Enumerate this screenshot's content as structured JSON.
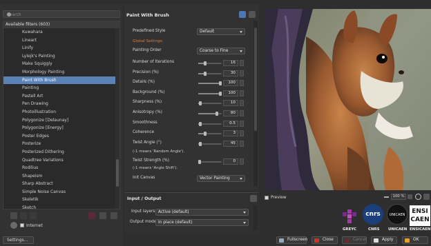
{
  "search": {
    "placeholder": "Search"
  },
  "filters": {
    "header": "Available filters (603)",
    "items": [
      "Kuwahara",
      "Lineart",
      "Linify",
      "Lylejk's Painting",
      "Make Squiggly",
      "Morphology Painting",
      "Paint With Brush",
      "Painting",
      "Pastell Art",
      "Pen Drawing",
      "Photoillustration",
      "Polygonize [Delaunay]",
      "Polygonize [Energy]",
      "Poster Edges",
      "Posterize",
      "Posterized Dithering",
      "Quadtree Variations",
      "Rodilius",
      "Shapeism",
      "Sharp Abstract",
      "Simple Noise Canvas",
      "Skeletik",
      "Sketch"
    ],
    "selected_index": 6,
    "internet_label": "Internet"
  },
  "settings_button": "Settings...",
  "panel": {
    "title": "Paint With Brush",
    "predefined_label": "Predefined Style",
    "predefined_value": "Default",
    "global_label": "Global Settings:",
    "painting_order_label": "Painting Order",
    "painting_order_value": "Coarse to Fine",
    "params": [
      {
        "label": "Number of Iterations",
        "value": "16",
        "fraction": 0.3
      },
      {
        "label": "Precision (%)",
        "value": "30",
        "fraction": 0.3
      },
      {
        "label": "Details (%)",
        "value": "100",
        "fraction": 1.0
      },
      {
        "label": "Background (%)",
        "value": "100",
        "fraction": 1.0
      },
      {
        "label": "Sharpness (%)",
        "value": "10",
        "fraction": 0.1
      },
      {
        "label": "Anisotropy (%)",
        "value": "80",
        "fraction": 0.8
      },
      {
        "label": "Smoothness",
        "value": "0.5",
        "fraction": 0.1
      },
      {
        "label": "Coherence",
        "value": "3",
        "fraction": 0.3
      },
      {
        "label": "Twist Angle (°)",
        "value": "45",
        "fraction": 0.1
      }
    ],
    "twist_angle_note": "(-1 means 'Random Angle').",
    "twist_strength_label": "Twist Strength (%)",
    "twist_strength_value": "0",
    "twist_strength_note": "(-1 means 'Angle Shift').",
    "init_canvas_label": "Init Canvas",
    "init_canvas_value": "Vector Painting"
  },
  "io": {
    "title": "Input / Output",
    "input_label": "Input layers",
    "input_value": "Active (default)",
    "output_label": "Output mode",
    "output_value": "In place (default)"
  },
  "preview": {
    "checkbox_label": "Preview",
    "zoom": "100 %"
  },
  "logos": [
    "GREYC",
    "CNRS",
    "UNICAEN",
    "ENSICAEN"
  ],
  "logo_texts": {
    "cnrs": "cnrs",
    "unicaen": "UNICAEN",
    "ensi": "ENSI",
    "caen": "CAEN"
  },
  "buttons": {
    "fullscreen": "Fullscreen",
    "close": "Close",
    "cancel": "Cancel",
    "apply": "Apply",
    "ok": "OK"
  },
  "colors": {
    "accent": "#5a82b4",
    "section": "#e07a30",
    "background": "#2e2e2e"
  }
}
